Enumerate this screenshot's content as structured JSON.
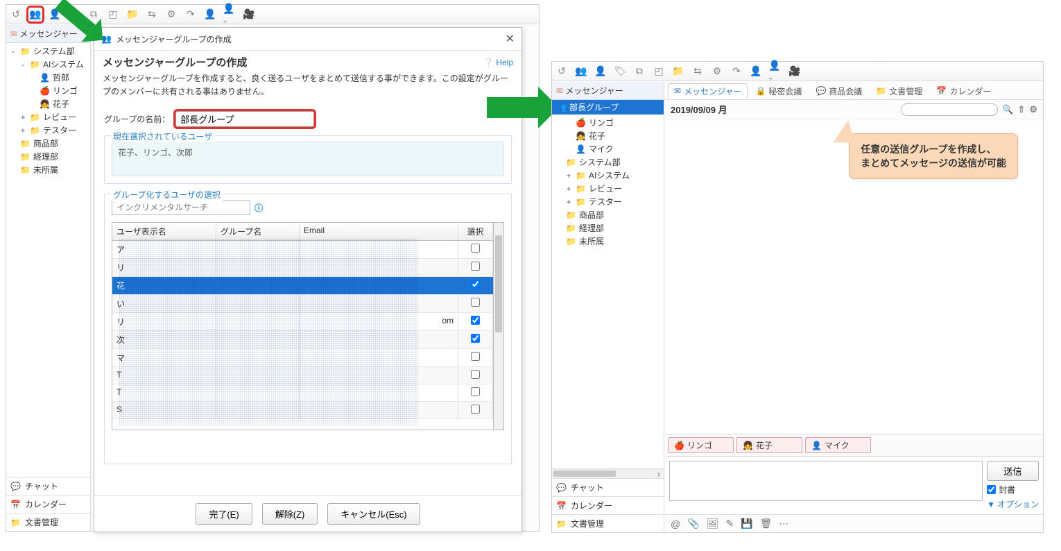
{
  "panel1": {
    "side_header": "メッセンジャー",
    "tree": [
      {
        "label": "システム部",
        "icon": "folder",
        "indent": 0,
        "expand": "-"
      },
      {
        "label": "AIシステム",
        "icon": "folder",
        "indent": 1,
        "expand": "-"
      },
      {
        "label": "哲郎",
        "icon": "person",
        "indent": 2,
        "expand": ""
      },
      {
        "label": "リンゴ",
        "icon": "person-r",
        "indent": 2,
        "expand": ""
      },
      {
        "label": "花子",
        "icon": "person-f",
        "indent": 2,
        "expand": ""
      },
      {
        "label": "レビュー",
        "icon": "folder",
        "indent": 1,
        "expand": "+"
      },
      {
        "label": "テスター",
        "icon": "folder",
        "indent": 1,
        "expand": "+"
      },
      {
        "label": "商品部",
        "icon": "folder",
        "indent": 0,
        "expand": ""
      },
      {
        "label": "経理部",
        "icon": "folder",
        "indent": 0,
        "expand": ""
      },
      {
        "label": "未所属",
        "icon": "folder",
        "indent": 0,
        "expand": ""
      }
    ],
    "bottom_items": [
      {
        "label": "チャット",
        "icon": "chat"
      },
      {
        "label": "カレンダー",
        "icon": "cal"
      },
      {
        "label": "文書管理",
        "icon": "doc"
      }
    ]
  },
  "dialog": {
    "window_title": "メッセンジャーグループの作成",
    "heading": "メッセンジャーグループの作成",
    "help": "Help",
    "description": "メッセンジャーグループを作成すると、良く送るユーザをまとめて送信する事ができます。この設定がグループのメンバーに共有される事はありません。",
    "name_label": "グループの名前：",
    "name_value": "部長グループ",
    "legend_selected": "現在選択されているユーザ",
    "selected_users_text": "花子、リンゴ、次郎",
    "legend_pick": "グループ化するユーザの選択",
    "search_placeholder": "インクリメンタルサーチ",
    "columns": {
      "name": "ユーザ表示名",
      "group": "グループ名",
      "email": "Email",
      "sel": "選択"
    },
    "rows": [
      {
        "n": "ア",
        "g": "",
        "e": "",
        "chk": false,
        "sel": false
      },
      {
        "n": "リ",
        "g": "",
        "e": "",
        "chk": false,
        "sel": false
      },
      {
        "n": "花",
        "g": "",
        "e": "",
        "chk": true,
        "sel": true
      },
      {
        "n": "い",
        "g": "",
        "e": "",
        "chk": false,
        "sel": false
      },
      {
        "n": "リ",
        "g": "",
        "e": "om",
        "chk": true,
        "sel": false
      },
      {
        "n": "次",
        "g": "",
        "e": "",
        "chk": true,
        "sel": false
      },
      {
        "n": "マ",
        "g": "",
        "e": "",
        "chk": false,
        "sel": false
      },
      {
        "n": "T",
        "g": "",
        "e": "",
        "chk": false,
        "sel": false
      },
      {
        "n": "T",
        "g": "",
        "e": "",
        "chk": false,
        "sel": false
      },
      {
        "n": "S",
        "g": "",
        "e": "",
        "chk": false,
        "sel": false
      }
    ],
    "buttons": {
      "ok": "完了(E)",
      "clear": "解除(Z)",
      "cancel": "キャンセル(Esc)"
    }
  },
  "panel2": {
    "side_header": "メッセンジャー",
    "group_selected": "部長グループ",
    "tree": [
      {
        "label": "リンゴ",
        "icon": "person-r",
        "indent": 1
      },
      {
        "label": "花子",
        "icon": "person-f",
        "indent": 1
      },
      {
        "label": "マイク",
        "icon": "person-b",
        "indent": 1
      },
      {
        "label": "システム部",
        "icon": "folder",
        "indent": 0
      },
      {
        "label": "AIシステム",
        "icon": "folder",
        "indent": 1,
        "expand": "+"
      },
      {
        "label": "レビュー",
        "icon": "folder",
        "indent": 1,
        "expand": "+"
      },
      {
        "label": "テスター",
        "icon": "folder",
        "indent": 1,
        "expand": "+"
      },
      {
        "label": "商品部",
        "icon": "folder",
        "indent": 0
      },
      {
        "label": "経理部",
        "icon": "folder",
        "indent": 0
      },
      {
        "label": "未所属",
        "icon": "folder",
        "indent": 0
      }
    ],
    "bottom_items": [
      {
        "label": "チャット",
        "icon": "chat"
      },
      {
        "label": "カレンダー",
        "icon": "cal"
      },
      {
        "label": "文書管理",
        "icon": "doc"
      }
    ],
    "tabs": [
      {
        "label": "メッセンジャー",
        "icon": "mail",
        "active": true
      },
      {
        "label": "秘密会議",
        "icon": "lock",
        "active": false
      },
      {
        "label": "商品会議",
        "icon": "chat",
        "active": false
      },
      {
        "label": "文書管理",
        "icon": "doc",
        "active": false
      },
      {
        "label": "カレンダー",
        "icon": "cal",
        "active": false
      }
    ],
    "date": "2019/09/09 月",
    "callout_line1": "任意の送信グループを作成し、",
    "callout_line2": "まとめてメッセージの送信が可能",
    "recipients": [
      "リンゴ",
      "花子",
      "マイク"
    ],
    "send": "送信",
    "seal": "封書",
    "option": "オプション"
  }
}
